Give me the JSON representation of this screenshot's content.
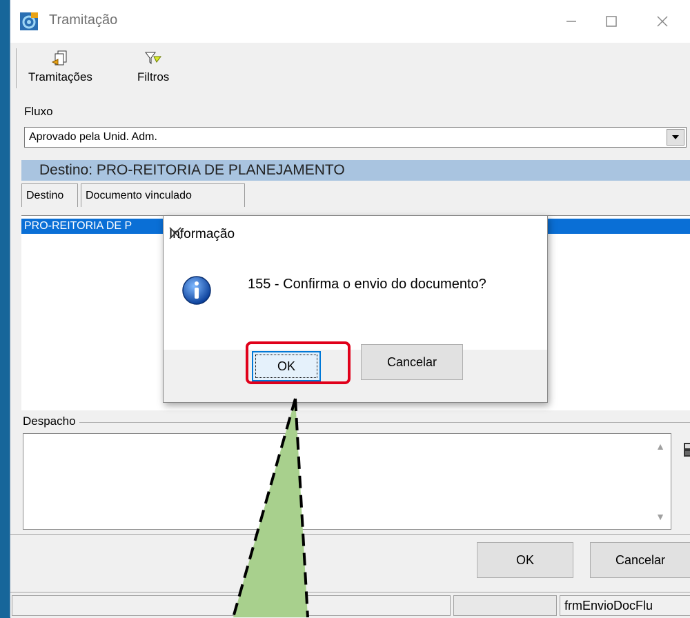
{
  "window": {
    "title": "Tramitação"
  },
  "toolbar": {
    "items": [
      {
        "label": "Tramitações",
        "icon": "tramitacoes-icon"
      },
      {
        "label": "Filtros",
        "icon": "filter-icon"
      }
    ]
  },
  "fluxo": {
    "label": "Fluxo",
    "selected": "Aprovado pela Unid. Adm."
  },
  "destino_bar": "Destino: PRO-REITORIA DE PLANEJAMENTO",
  "tabs": [
    "Destino",
    "Documento vinculado"
  ],
  "list": {
    "selected_row": "PRO-REITORIA DE P"
  },
  "despacho": {
    "label": "Despacho",
    "value": ""
  },
  "buttons": {
    "ok": "OK",
    "cancel": "Cancelar"
  },
  "status": {
    "form_name": "frmEnvioDocFlu"
  },
  "dialog": {
    "title": "Informação",
    "message": "155 - Confirma o envio do documento?",
    "ok": "OK",
    "cancel": "Cancelar",
    "icon": "info-icon"
  },
  "colors": {
    "accent": "#0078d7",
    "highlight": "#e0001a",
    "callout": "#a8d08d",
    "background": "#17669a"
  }
}
